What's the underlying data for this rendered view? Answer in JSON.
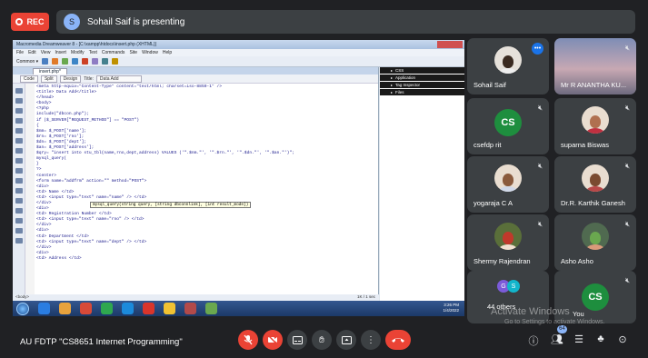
{
  "top": {
    "rec_label": "REC",
    "presenting_text": "Sohail Saif is presenting"
  },
  "shared_screen": {
    "window_title": "Macromedia Dreamweaver 8 - [C:\\xampp\\htdocs\\insert.php (XHTML)]",
    "menu": [
      "File",
      "Edit",
      "View",
      "Insert",
      "Modify",
      "Text",
      "Commands",
      "Site",
      "Window",
      "Help"
    ],
    "insert_bar_label": "Common ▾",
    "doc_tab": "insert.php*",
    "view_buttons": [
      "Code",
      "Split",
      "Design"
    ],
    "title_label": "Title:",
    "title_value": "Data Add",
    "code_lines": [
      "<meta http-equiv=\"Content-Type\" content=\"text/html; charset=iso-8859-1\" />",
      "<title> Data Add</title>",
      "</head>",
      "",
      "<body>",
      "<?php",
      "include(\"dbcon.php\");",
      "if ($_SERVER[\"REQUEST_METHOD\"] == \"POST\")",
      "{",
      "$nm= $_POST['name'];",
      "$rn= $_POST['rno'];",
      "$dn= $_POST['dept'];",
      "$an= $_POST['address'];",
      "",
      "$qry= \"insert into stu_tbl(name,rno,dept,address) VALUES ('\".$nm.\"', '\".$rn.\"', '\".$dn.\"', '\".$an.\"')\";",
      "mysql_query(",
      "}",
      "?>",
      "<center>",
      "<form name=\"addfrm\" action=\"\" method=\"POST\">",
      "<div>",
      "<td> Name </td>",
      "<td> <input type=\"text\" name=\"name\" /> </td>",
      "</div>",
      "<div>",
      "<td> Registration Number </td>",
      "<td> <input type=\"text\" name=\"rno\" /> </td>",
      "</div>",
      "<div>",
      "<td> Department </td>",
      "<td> <input type=\"text\" name=\"dept\" /> </td>",
      "</div>",
      "<div>",
      "<td> Address </td>"
    ],
    "tooltip": "mysql_query(string query, [string dbconnlink], [int result_mode])",
    "status_left": "<body>",
    "status_right": "1K / 1 sec",
    "panels": [
      "CSS",
      "Application",
      "Tag Inspector",
      "Files"
    ],
    "tray_time": "3:26 PM",
    "tray_date": "1/4/2022"
  },
  "participants": [
    {
      "name": "Sohail Saif",
      "type": "photo",
      "more": "•••"
    },
    {
      "name": "Mr R ANANTHA KU...",
      "type": "photo",
      "muted": true
    },
    {
      "name": "csefdp rit",
      "type": "initials",
      "initials": "CS",
      "muted": true
    },
    {
      "name": "suparna Biswas",
      "type": "photo",
      "muted": true
    },
    {
      "name": "yogaraja C A",
      "type": "photo",
      "muted": true
    },
    {
      "name": "Dr.R. Karthik Ganesh",
      "type": "photo",
      "muted": true
    },
    {
      "name": "Shermy Rajendran",
      "type": "photo",
      "muted": true
    },
    {
      "name": "Asho Asho",
      "type": "photo",
      "muted": true
    },
    {
      "name": "44 others",
      "type": "group",
      "g": "G",
      "s": "S"
    },
    {
      "name": "You",
      "type": "initials",
      "initials": "CS",
      "muted": true
    }
  ],
  "watermark": {
    "line1": "Activate Windows",
    "line2": "Go to Settings to activate Windows."
  },
  "bottom": {
    "meeting_title": "AU FDTP \"CS8651 Internet Programming\"",
    "people_count": "64"
  },
  "colors": {
    "background": "#202124",
    "tile": "#3c4043",
    "red": "#ea4335",
    "blue": "#1a73e8",
    "green": "#1e8e3e"
  }
}
